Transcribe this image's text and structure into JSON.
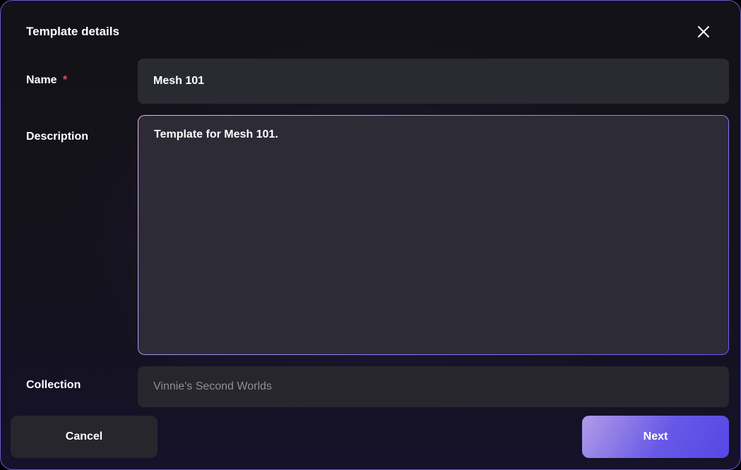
{
  "dialog": {
    "title": "Template details"
  },
  "form": {
    "name": {
      "label": "Name",
      "required_marker": "*",
      "value": "Mesh 101"
    },
    "description": {
      "label": "Description",
      "value": "Template for Mesh 101."
    },
    "collection": {
      "label": "Collection",
      "value": "Vinnie's Second Worlds"
    }
  },
  "footer": {
    "cancel_label": "Cancel",
    "next_label": "Next"
  }
}
